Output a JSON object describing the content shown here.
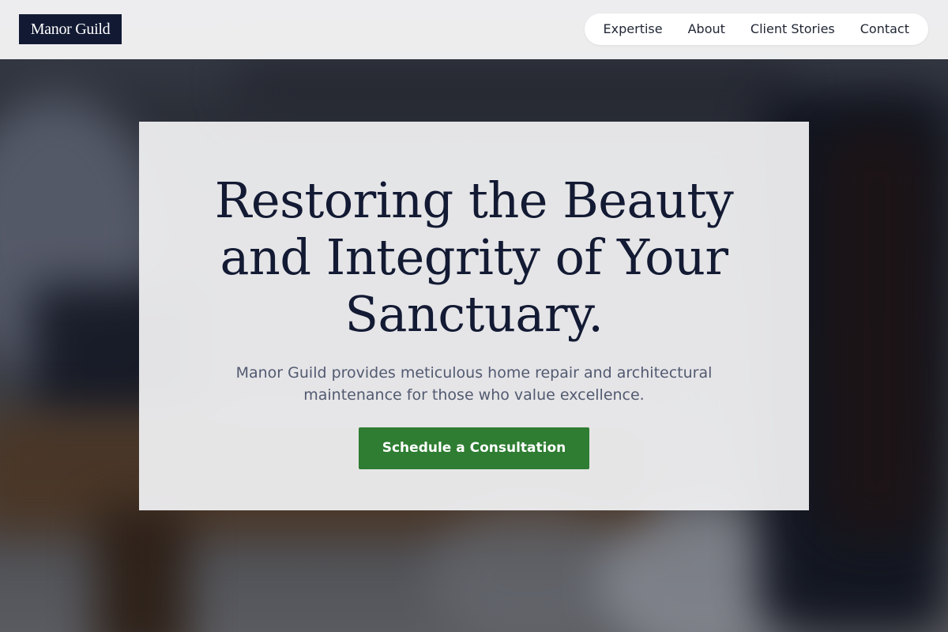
{
  "brand": {
    "name": "Manor Guild"
  },
  "nav": {
    "items": [
      {
        "label": "Expertise"
      },
      {
        "label": "About"
      },
      {
        "label": "Client Stories"
      },
      {
        "label": "Contact"
      }
    ]
  },
  "hero": {
    "title": "Restoring the Beauty and Integrity of Your Sanctuary.",
    "subtitle": "Manor Guild provides meticulous home repair and architectural maintenance for those who value excellence.",
    "cta_label": "Schedule a Consultation"
  },
  "colors": {
    "brand_navy": "#121a33",
    "cta_green": "#2e7d32",
    "subtitle_gray": "#525a70"
  }
}
